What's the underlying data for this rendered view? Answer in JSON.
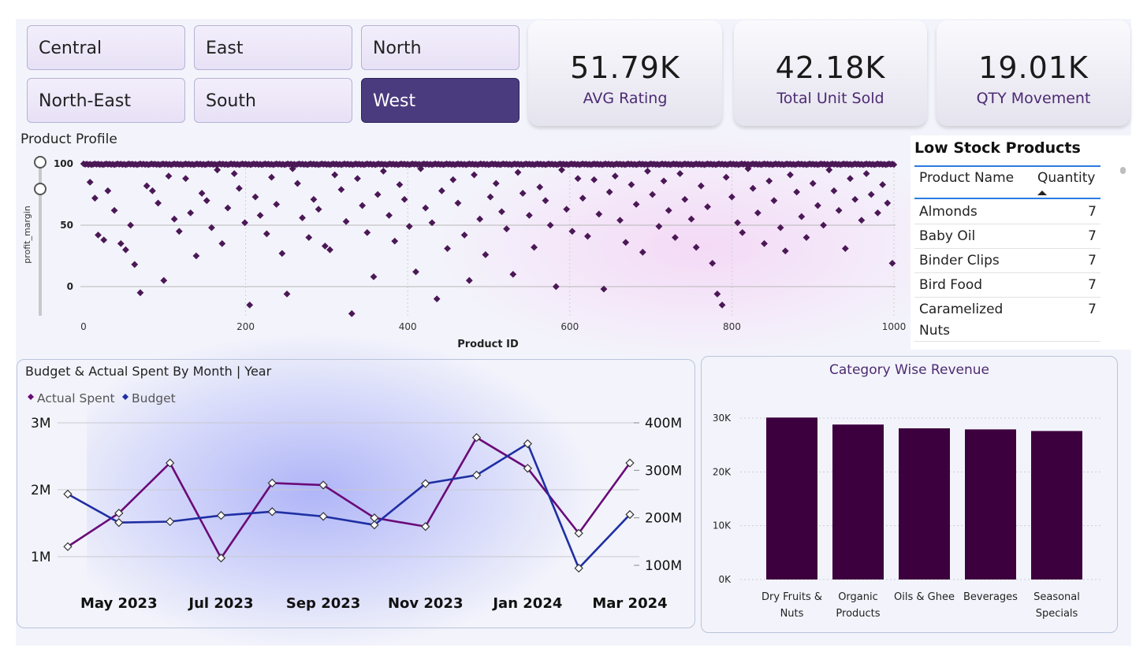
{
  "slicer": {
    "items": [
      {
        "label": "Central",
        "selected": false
      },
      {
        "label": "East",
        "selected": false
      },
      {
        "label": "North",
        "selected": false
      },
      {
        "label": "North-East",
        "selected": false
      },
      {
        "label": "South",
        "selected": false
      },
      {
        "label": "West",
        "selected": true
      }
    ]
  },
  "kpis": [
    {
      "value": "51.79K",
      "label": "AVG Rating"
    },
    {
      "value": "42.18K",
      "label": "Total Unit Sold"
    },
    {
      "value": "19.01K",
      "label": "QTY Movement"
    }
  ],
  "product_profile": {
    "title": "Product Profile"
  },
  "low_stock": {
    "title": "Low Stock Products",
    "headers": [
      "Product Name",
      "Quantity"
    ],
    "rows": [
      {
        "name": "Almonds",
        "qty": "7"
      },
      {
        "name": "Baby Oil",
        "qty": "7"
      },
      {
        "name": "Binder Clips",
        "qty": "7"
      },
      {
        "name": "Bird Food",
        "qty": "7"
      },
      {
        "name_line1": "Caramelized",
        "name_line2": "Nuts",
        "qty": "7"
      }
    ]
  },
  "budget_panel": {
    "title": "Budget & Actual Spent By Month | Year"
  },
  "revenue_panel": {
    "title": "Category Wise Revenue"
  },
  "colors": {
    "purple": "#6a0a78",
    "navy": "#1f2fa3",
    "bar": "#3c003e",
    "scatter": "#4b1856",
    "selected_slicer": "#4a3a7e"
  },
  "chart_data": [
    {
      "type": "scatter",
      "xlabel": "Product ID",
      "ylabel": "profit_margin",
      "xlim": [
        0,
        1000
      ],
      "ylim": [
        -25,
        100
      ],
      "xticks": [
        "0",
        "200",
        "400",
        "600",
        "800",
        "1000"
      ],
      "yticks": [
        "0",
        "50",
        "100"
      ],
      "points_description": "~1000 products; dense band at profit_margin 100, remainder scattered 0-100 with a few below 0",
      "points": [
        [
          8,
          85
        ],
        [
          14,
          72
        ],
        [
          18,
          42
        ],
        [
          25,
          38
        ],
        [
          30,
          78
        ],
        [
          38,
          62
        ],
        [
          46,
          35
        ],
        [
          52,
          30
        ],
        [
          58,
          50
        ],
        [
          63,
          18
        ],
        [
          70,
          -5
        ],
        [
          78,
          82
        ],
        [
          85,
          78
        ],
        [
          92,
          68
        ],
        [
          99,
          5
        ],
        [
          105,
          90
        ],
        [
          112,
          55
        ],
        [
          118,
          45
        ],
        [
          126,
          88
        ],
        [
          132,
          60
        ],
        [
          139,
          25
        ],
        [
          146,
          76
        ],
        [
          152,
          70
        ],
        [
          158,
          48
        ],
        [
          165,
          95
        ],
        [
          171,
          35
        ],
        [
          178,
          64
        ],
        [
          186,
          92
        ],
        [
          192,
          80
        ],
        [
          199,
          52
        ],
        [
          205,
          -15
        ],
        [
          212,
          73
        ],
        [
          218,
          58
        ],
        [
          226,
          43
        ],
        [
          232,
          89
        ],
        [
          238,
          67
        ],
        [
          245,
          27
        ],
        [
          251,
          -6
        ],
        [
          258,
          96
        ],
        [
          264,
          84
        ],
        [
          270,
          56
        ],
        [
          278,
          40
        ],
        [
          284,
          71
        ],
        [
          290,
          63
        ],
        [
          298,
          33
        ],
        [
          304,
          30
        ],
        [
          310,
          91
        ],
        [
          318,
          79
        ],
        [
          324,
          53
        ],
        [
          331,
          -22
        ],
        [
          338,
          88
        ],
        [
          344,
          66
        ],
        [
          350,
          44
        ],
        [
          358,
          8
        ],
        [
          363,
          75
        ],
        [
          370,
          94
        ],
        [
          377,
          58
        ],
        [
          384,
          37
        ],
        [
          390,
          83
        ],
        [
          396,
          71
        ],
        [
          402,
          49
        ],
        [
          410,
          12
        ],
        [
          416,
          96
        ],
        [
          422,
          64
        ],
        [
          430,
          52
        ],
        [
          436,
          -10
        ],
        [
          442,
          78
        ],
        [
          449,
          31
        ],
        [
          456,
          87
        ],
        [
          462,
          68
        ],
        [
          470,
          42
        ],
        [
          476,
          5
        ],
        [
          482,
          91
        ],
        [
          489,
          55
        ],
        [
          496,
          26
        ],
        [
          502,
          73
        ],
        [
          509,
          84
        ],
        [
          516,
          61
        ],
        [
          522,
          47
        ],
        [
          530,
          10
        ],
        [
          536,
          93
        ],
        [
          542,
          76
        ],
        [
          550,
          58
        ],
        [
          556,
          32
        ],
        [
          563,
          81
        ],
        [
          570,
          70
        ],
        [
          576,
          50
        ],
        [
          583,
          0
        ],
        [
          590,
          95
        ],
        [
          596,
          63
        ],
        [
          603,
          45
        ],
        [
          610,
          88
        ],
        [
          616,
          72
        ],
        [
          622,
          41
        ],
        [
          630,
          87
        ],
        [
          636,
          59
        ],
        [
          642,
          -2
        ],
        [
          649,
          77
        ],
        [
          656,
          90
        ],
        [
          662,
          54
        ],
        [
          669,
          36
        ],
        [
          676,
          83
        ],
        [
          682,
          67
        ],
        [
          690,
          28
        ],
        [
          696,
          94
        ],
        [
          702,
          75
        ],
        [
          710,
          49
        ],
        [
          716,
          86
        ],
        [
          722,
          62
        ],
        [
          730,
          40
        ],
        [
          736,
          92
        ],
        [
          742,
          71
        ],
        [
          750,
          55
        ],
        [
          756,
          32
        ],
        [
          762,
          82
        ],
        [
          770,
          65
        ],
        [
          776,
          19
        ],
        [
          782,
          -6
        ],
        [
          788,
          -15
        ],
        [
          793,
          89
        ],
        [
          800,
          73
        ],
        [
          807,
          52
        ],
        [
          813,
          44
        ],
        [
          820,
          96
        ],
        [
          826,
          80
        ],
        [
          832,
          60
        ],
        [
          840,
          35
        ],
        [
          846,
          86
        ],
        [
          852,
          70
        ],
        [
          860,
          48
        ],
        [
          866,
          29
        ],
        [
          872,
          91
        ],
        [
          880,
          77
        ],
        [
          886,
          57
        ],
        [
          892,
          40
        ],
        [
          900,
          84
        ],
        [
          906,
          66
        ],
        [
          913,
          50
        ],
        [
          920,
          95
        ],
        [
          926,
          78
        ],
        [
          932,
          62
        ],
        [
          940,
          31
        ],
        [
          946,
          88
        ],
        [
          952,
          71
        ],
        [
          960,
          54
        ],
        [
          966,
          92
        ],
        [
          972,
          75
        ],
        [
          980,
          60
        ],
        [
          986,
          83
        ],
        [
          992,
          68
        ],
        [
          998,
          19
        ]
      ]
    },
    {
      "type": "line",
      "title": "Budget & Actual Spent By Month | Year",
      "x": [
        "Apr 2023",
        "May 2023",
        "Jun 2023",
        "Jul 2023",
        "Aug 2023",
        "Sep 2023",
        "Oct 2023",
        "Nov 2023",
        "Dec 2023",
        "Jan 2024",
        "Feb 2024",
        "Mar 2024"
      ],
      "xticks": [
        "May 2023",
        "Jul 2023",
        "Sep 2023",
        "Nov 2023",
        "Jan 2024",
        "Mar 2024"
      ],
      "series": [
        {
          "name": "Actual Spent",
          "axis": "left",
          "values": [
            1.15,
            1.65,
            2.4,
            0.98,
            2.1,
            2.07,
            1.58,
            1.45,
            2.78,
            2.32,
            1.35,
            2.4
          ]
        },
        {
          "name": "Budget",
          "axis": "right",
          "values": [
            250,
            190,
            192,
            205,
            213,
            203,
            185,
            272,
            290,
            356,
            94,
            207
          ]
        }
      ],
      "y_left": {
        "ticks": [
          "1M",
          "2M",
          "3M"
        ],
        "values": [
          1,
          2,
          3
        ],
        "unit": "M"
      },
      "y_right": {
        "ticks": [
          "100M",
          "200M",
          "300M",
          "400M"
        ],
        "values": [
          100,
          200,
          300,
          400
        ],
        "unit": "M"
      },
      "legend": "top-left",
      "grid": true
    },
    {
      "type": "bar",
      "title": "Category Wise Revenue",
      "categories": [
        [
          "Dry Fruits &",
          "Nuts"
        ],
        [
          "Organic",
          "Products"
        ],
        [
          "Oils & Ghee"
        ],
        [
          "Beverages"
        ],
        [
          "Seasonal",
          "Specials"
        ]
      ],
      "values": [
        30100,
        28800,
        28100,
        27900,
        27600
      ],
      "yticks": [
        "0K",
        "10K",
        "20K",
        "30K"
      ],
      "ylim": [
        0,
        30000
      ],
      "grid": true
    }
  ]
}
